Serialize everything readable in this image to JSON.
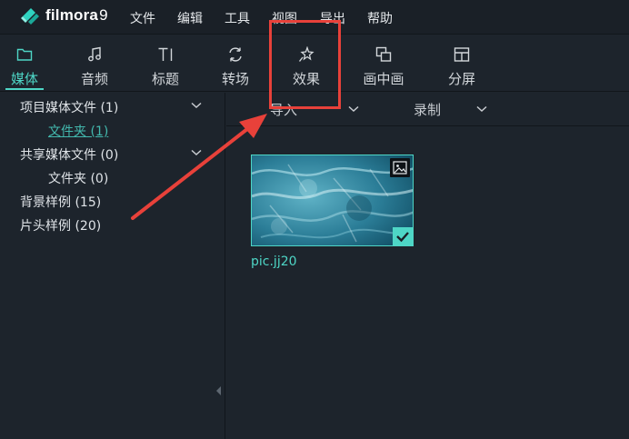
{
  "app": {
    "brand": "filmora",
    "version": "9"
  },
  "menu": [
    {
      "label": "文件"
    },
    {
      "label": "编辑"
    },
    {
      "label": "工具"
    },
    {
      "label": "视图"
    },
    {
      "label": "导出"
    },
    {
      "label": "帮助"
    }
  ],
  "toolbar": {
    "tabs": [
      {
        "label": "媒体",
        "icon": "folder-icon",
        "active": true
      },
      {
        "label": "音频",
        "icon": "music-note-icon",
        "active": false
      },
      {
        "label": "标题",
        "icon": "text-title-icon",
        "active": false
      },
      {
        "label": "转场",
        "icon": "transition-icon",
        "active": false
      },
      {
        "label": "效果",
        "icon": "effects-icon",
        "active": false
      },
      {
        "label": "画中画",
        "icon": "picture-in-picture-icon",
        "active": false
      },
      {
        "label": "分屏",
        "icon": "split-screen-icon",
        "active": false
      }
    ]
  },
  "sidebar": {
    "items": [
      {
        "label": "项目媒体文件 (1)",
        "expandable": true
      },
      {
        "label": "文件夹 (1)",
        "selected": true
      },
      {
        "label": "共享媒体文件 (0)",
        "expandable": true
      },
      {
        "label": "文件夹 (0)"
      },
      {
        "label": "背景样例 (15)"
      },
      {
        "label": "片头样例 (20)"
      }
    ]
  },
  "filters": {
    "import_label": "导入",
    "record_label": "录制"
  },
  "media": {
    "items": [
      {
        "name": "pic.jj20",
        "type": "image",
        "selected": true
      }
    ]
  },
  "colors": {
    "accent": "#4ed6c6",
    "background": "#1d242c",
    "annotation": "#e8413a"
  }
}
